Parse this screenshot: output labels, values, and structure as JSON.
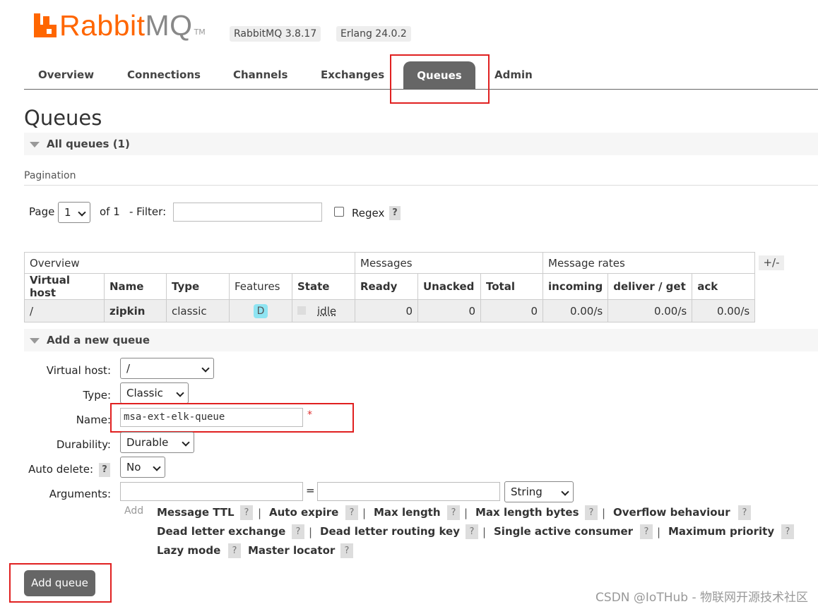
{
  "header": {
    "logo_text_rabbit": "Rabbit",
    "logo_text_mq": "MQ",
    "logo_tm": "TM",
    "rabbitmq_version": "RabbitMQ 3.8.17",
    "erlang_version": "Erlang 24.0.2",
    "brand_color": "#ff6600"
  },
  "tabs": [
    {
      "label": "Overview"
    },
    {
      "label": "Connections"
    },
    {
      "label": "Channels"
    },
    {
      "label": "Exchanges"
    },
    {
      "label": "Queues",
      "active": true
    },
    {
      "label": "Admin"
    }
  ],
  "page_title": "Queues",
  "all_queues": {
    "label": "All queues (1)"
  },
  "pagination": {
    "section_label": "Pagination",
    "page_label": "Page",
    "page_value": "1",
    "of_label": "of 1",
    "filter_label": "- Filter:",
    "filter_value": "",
    "regex_label": "Regex",
    "regex_checked": false,
    "help": "?"
  },
  "table": {
    "groups": [
      "Overview",
      "Messages",
      "Message rates"
    ],
    "columns": [
      "Virtual host",
      "Name",
      "Type",
      "Features",
      "State",
      "Ready",
      "Unacked",
      "Total",
      "incoming",
      "deliver / get",
      "ack"
    ],
    "rows": [
      {
        "vhost": "/",
        "name": "zipkin",
        "type": "classic",
        "features": "D",
        "state": "idle",
        "ready": "0",
        "unacked": "0",
        "total": "0",
        "incoming": "0.00/s",
        "deliver_get": "0.00/s",
        "ack": "0.00/s"
      }
    ],
    "toggle_columns": "+/-"
  },
  "add_queue": {
    "section_label": "Add a new queue",
    "virtual_host_label": "Virtual host:",
    "virtual_host_value": "/",
    "type_label": "Type:",
    "type_value": "Classic",
    "name_label": "Name:",
    "name_value": "msa-ext-elk-queue",
    "required_mark": "*",
    "durability_label": "Durability:",
    "durability_value": "Durable",
    "auto_delete_label": "Auto delete:",
    "auto_delete_value": "No",
    "arguments_label": "Arguments:",
    "arg_key": "",
    "arg_equals": "=",
    "arg_value": "",
    "arg_type": "String",
    "add_label": "Add",
    "argument_shortcuts": [
      "Message TTL",
      "Auto expire",
      "Max length",
      "Max length bytes",
      "Overflow behaviour",
      "Dead letter exchange",
      "Dead letter routing key",
      "Single active consumer",
      "Maximum priority",
      "Lazy mode",
      "Master locator"
    ],
    "separator": "|",
    "help": "?",
    "submit_label": "Add queue"
  },
  "watermark": "CSDN @IoTHub - 物联网开源技术社区",
  "highlight_color": "#e02020"
}
